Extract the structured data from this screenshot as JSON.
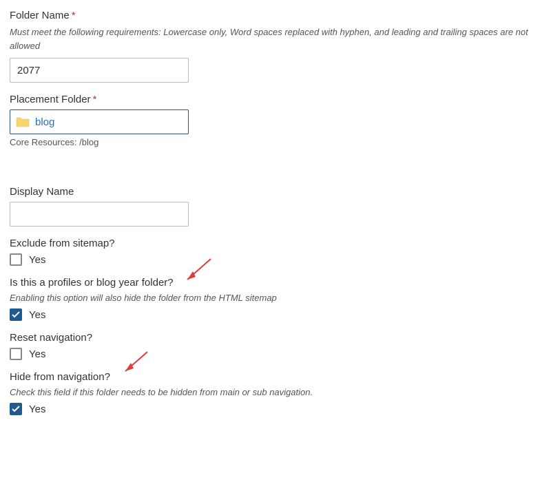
{
  "folderName": {
    "label": "Folder Name",
    "required": "*",
    "help": "Must meet the following requirements: Lowercase only, Word spaces replaced with hyphen, and leading and trailing spaces are not allowed",
    "value": "2077"
  },
  "placementFolder": {
    "label": "Placement Folder",
    "required": "*",
    "value": "blog",
    "path": "Core Resources: /blog"
  },
  "displayName": {
    "label": "Display Name",
    "value": ""
  },
  "excludeSitemap": {
    "label": "Exclude from sitemap?",
    "optionLabel": "Yes",
    "checked": false
  },
  "profilesOrBlogYear": {
    "label": "Is this a profiles or blog year folder?",
    "help": "Enabling this option will also hide the folder from the HTML sitemap",
    "optionLabel": "Yes",
    "checked": true
  },
  "resetNavigation": {
    "label": "Reset navigation?",
    "optionLabel": "Yes",
    "checked": false
  },
  "hideFromNavigation": {
    "label": "Hide from navigation?",
    "help": "Check this field if this folder needs to be hidden from main or sub navigation.",
    "optionLabel": "Yes",
    "checked": true
  }
}
